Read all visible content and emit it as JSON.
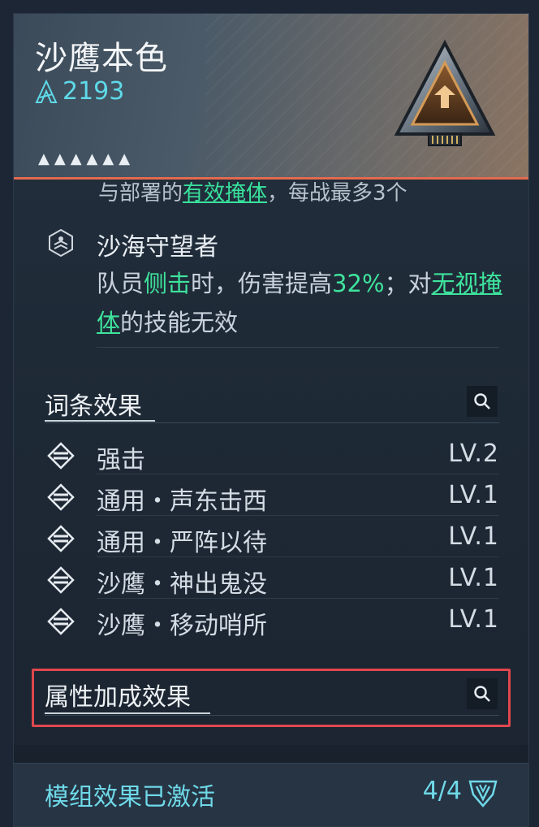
{
  "header": {
    "title": "沙鹰本色",
    "power": "2193",
    "stars": [
      "▲",
      "▲",
      "▲",
      "▲",
      "▲",
      "▲"
    ],
    "accent_color": "#e36a4e"
  },
  "cut_text": {
    "prefix": "与部署的",
    "highlight": "有效掩体",
    "suffix": "，每战最多3个"
  },
  "skill": {
    "name": "沙海守望者",
    "desc_1": "队员",
    "desc_2": "侧击",
    "desc_3": "时，伤害提高",
    "desc_4": "32%",
    "desc_5": "；对",
    "desc_6": "无视掩体",
    "desc_7": "的技能无效"
  },
  "entries_section": {
    "title": "词条效果",
    "items": [
      {
        "name": "强击",
        "level": "LV.2"
      },
      {
        "name": "通用・声东击西",
        "level": "LV.1"
      },
      {
        "name": "通用・严阵以待",
        "level": "LV.1"
      },
      {
        "name": "沙鹰・神出鬼没",
        "level": "LV.1"
      },
      {
        "name": "沙鹰・移动哨所",
        "level": "LV.1"
      }
    ]
  },
  "attributes_section": {
    "title": "属性加成效果"
  },
  "footer": {
    "label": "模组效果已激活",
    "count": "4/4"
  },
  "colors": {
    "green_highlight": "#3ee39c",
    "cyan": "#5fd9e8",
    "highlight_box": "#e0474e"
  }
}
